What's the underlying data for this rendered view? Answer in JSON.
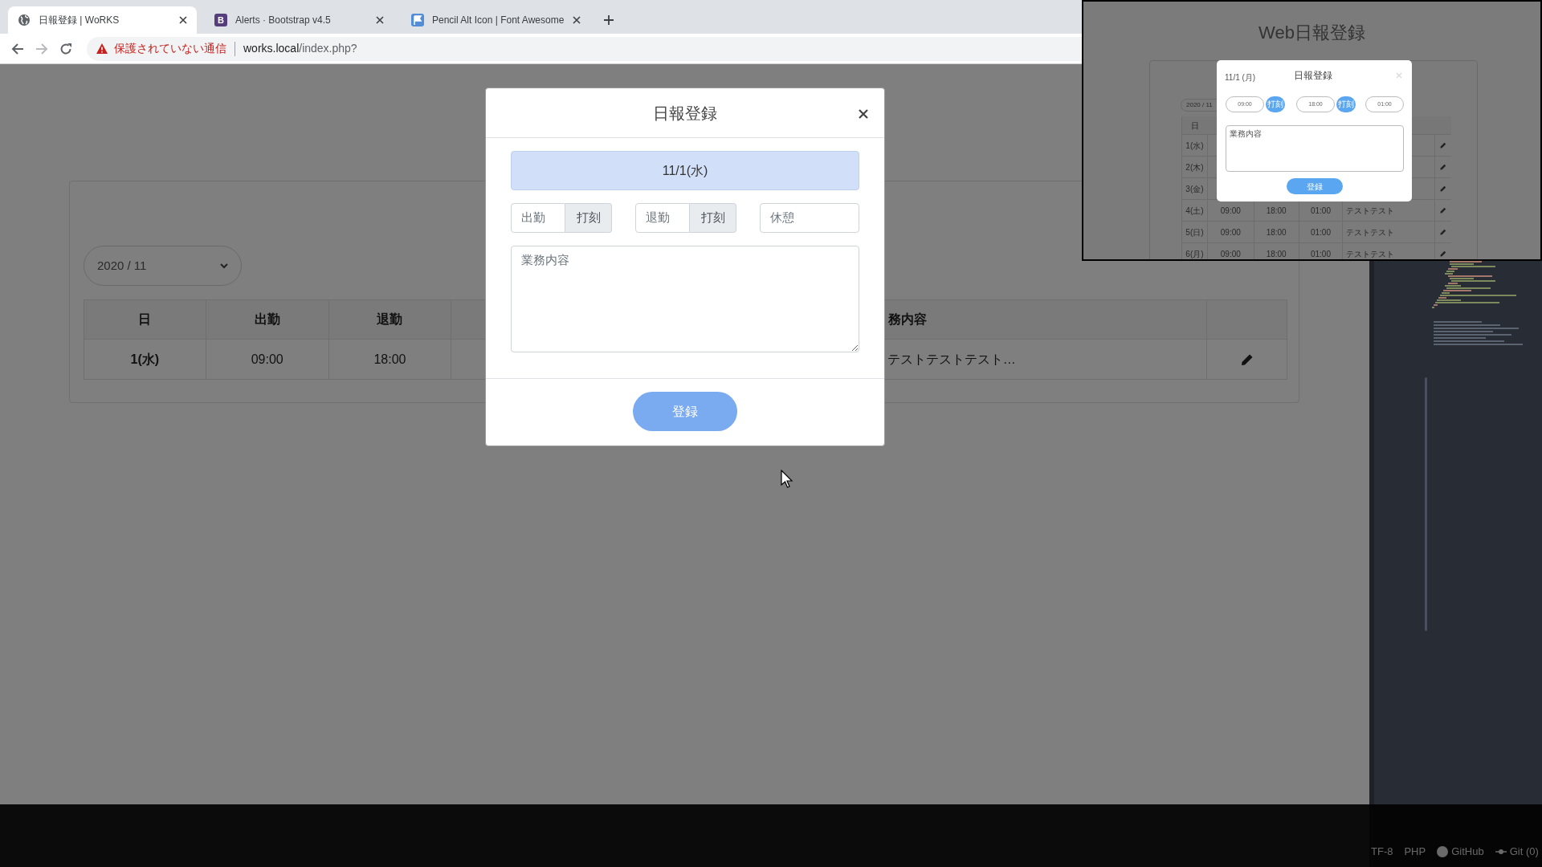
{
  "browser": {
    "tabs": [
      {
        "title": "日報登録 | WoRKS",
        "selected": true
      },
      {
        "title": "Alerts · Bootstrap v4.5",
        "icon_letter": "B",
        "selected": false
      },
      {
        "title": "Pencil Alt Icon | Font Awesome",
        "selected": false
      }
    ],
    "forward_disabled": true,
    "address": {
      "warning": "保護されていない通信",
      "host": "works.local",
      "path": "/index.php?"
    }
  },
  "page": {
    "month_select": "2020 / 11",
    "header": {
      "column_1": "日",
      "column_2": "出勤",
      "column_3": "退勤",
      "column_5": "務内容"
    },
    "rows": [
      {
        "column_1": "1(水)",
        "column_2": "09:00",
        "column_3": "18:00",
        "column_5": "テストテストテスト…"
      }
    ]
  },
  "modal": {
    "title": "日報登録",
    "date": "11/1(水)",
    "clock_in": {
      "placeholder": "出勤",
      "button": "打刻"
    },
    "clock_out": {
      "placeholder": "退勤",
      "button": "打刻"
    },
    "break": {
      "placeholder": "休憩"
    },
    "content": {
      "placeholder": "業務内容"
    },
    "submit": "登録"
  },
  "preview": {
    "title": "Web日報登録",
    "month_select": "2020 / 11",
    "header_day": "日",
    "rows": [
      {
        "day": "1(水)"
      },
      {
        "day": "2(木)"
      },
      {
        "day": "3(金)"
      },
      {
        "day": "4(土)",
        "clock_in": "09:00",
        "clock_out": "18:00",
        "break": "01:00",
        "content": "テストテスト"
      },
      {
        "day": "5(日)",
        "clock_in": "09:00",
        "clock_out": "18:00",
        "break": "01:00",
        "content": "テストテスト"
      },
      {
        "day": "6(月)",
        "clock_in": "09:00",
        "clock_out": "18:00",
        "break": "01:00",
        "content": "テストテスト"
      }
    ],
    "modal": {
      "date": "11/1 (月)",
      "title": "日報登録",
      "clock_in": "09:00",
      "clock_in_button": "打刻",
      "clock_out": "18:00",
      "clock_out_button": "打刻",
      "break": "01:00",
      "content_placeholder": "業務内容",
      "submit": "登録"
    }
  },
  "status_bar": [
    {
      "label": "TF-8"
    },
    {
      "label": "PHP"
    },
    {
      "label": "GitHub"
    },
    {
      "label": "Git (0)"
    }
  ]
}
